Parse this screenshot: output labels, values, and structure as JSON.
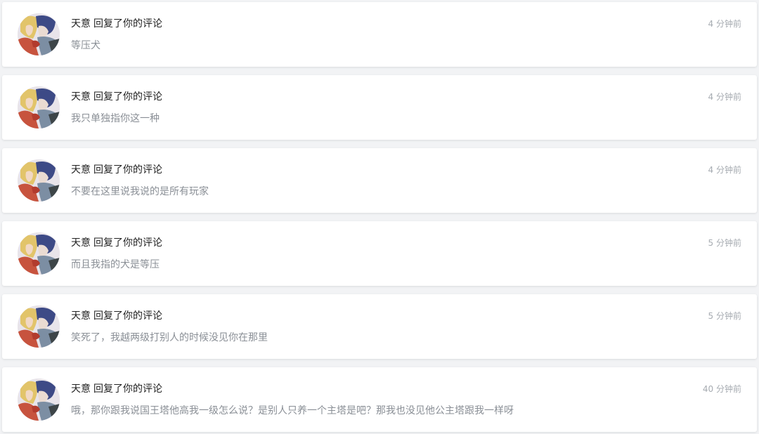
{
  "notifications": [
    {
      "user": "天意",
      "action": "回复了你的评论",
      "content": "等压犬",
      "time": "4 分钟前"
    },
    {
      "user": "天意",
      "action": "回复了你的评论",
      "content": "我只单独指你这一种",
      "time": "4 分钟前"
    },
    {
      "user": "天意",
      "action": "回复了你的评论",
      "content": "不要在这里说我说的是所有玩家",
      "time": "4 分钟前"
    },
    {
      "user": "天意",
      "action": "回复了你的评论",
      "content": "而且我指的犬是等压",
      "time": "5 分钟前"
    },
    {
      "user": "天意",
      "action": "回复了你的评论",
      "content": "笑死了，我越两级打别人的时候没见你在那里",
      "time": "5 分钟前"
    },
    {
      "user": "天意",
      "action": "回复了你的评论",
      "content": "哦，那你跟我说国王塔他高我一级怎么说？是别人只养一个主塔是吧？那我也没见他公主塔跟我一样呀",
      "time": "40 分钟前"
    }
  ]
}
